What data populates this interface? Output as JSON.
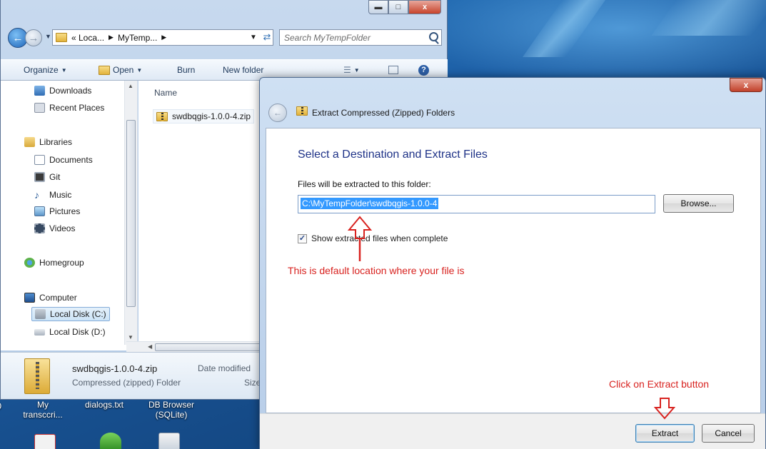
{
  "explorer": {
    "address": {
      "segments": [
        "« Loca...",
        "MyTemp..."
      ]
    },
    "search_placeholder": "Search MyTempFolder",
    "toolbar": {
      "organize": "Organize",
      "open": "Open",
      "burn": "Burn",
      "new_folder": "New folder"
    },
    "nav_pane": {
      "favorites": [
        "Downloads",
        "Recent Places"
      ],
      "libraries_header": "Libraries",
      "libraries": [
        "Documents",
        "Git",
        "Music",
        "Pictures",
        "Videos"
      ],
      "homegroup": "Homegroup",
      "computer_header": "Computer",
      "drives": [
        "Local Disk (C:)",
        "Local Disk (D:)"
      ],
      "selected_drive": "Local Disk (C:)"
    },
    "file_list": {
      "column_name": "Name",
      "files": [
        {
          "name": "swdbqgis-1.0.0-4.zip"
        }
      ]
    },
    "details": {
      "file_name": "swdbqgis-1.0.0-4.zip",
      "file_type": "Compressed (zipped) Folder",
      "date_label": "Date modified",
      "size_label": "Size"
    }
  },
  "desktop": {
    "icons": [
      {
        "label_line1": "My",
        "label_line2": "transccri..."
      },
      {
        "label_line1": "dialogs.txt",
        "label_line2": ""
      },
      {
        "label_line1": "DB Browser",
        "label_line2": "(SQLite)"
      }
    ],
    "partial_label": ".0"
  },
  "dialog": {
    "close": "x",
    "title": "Extract Compressed (Zipped) Folders",
    "heading": "Select a Destination and Extract Files",
    "label": "Files will be extracted to this folder:",
    "destination": "C:\\MyTempFolder\\swdbqgis-1.0.0-4",
    "browse_button": "Browse...",
    "show_files_label": "Show extracted files when complete",
    "show_files_checked": true,
    "extract_button": "Extract",
    "cancel_button": "Cancel"
  },
  "annotations": {
    "default_location": "This is default location where your file is",
    "click_extract": "Click on Extract button",
    "color": "#d8221f"
  }
}
